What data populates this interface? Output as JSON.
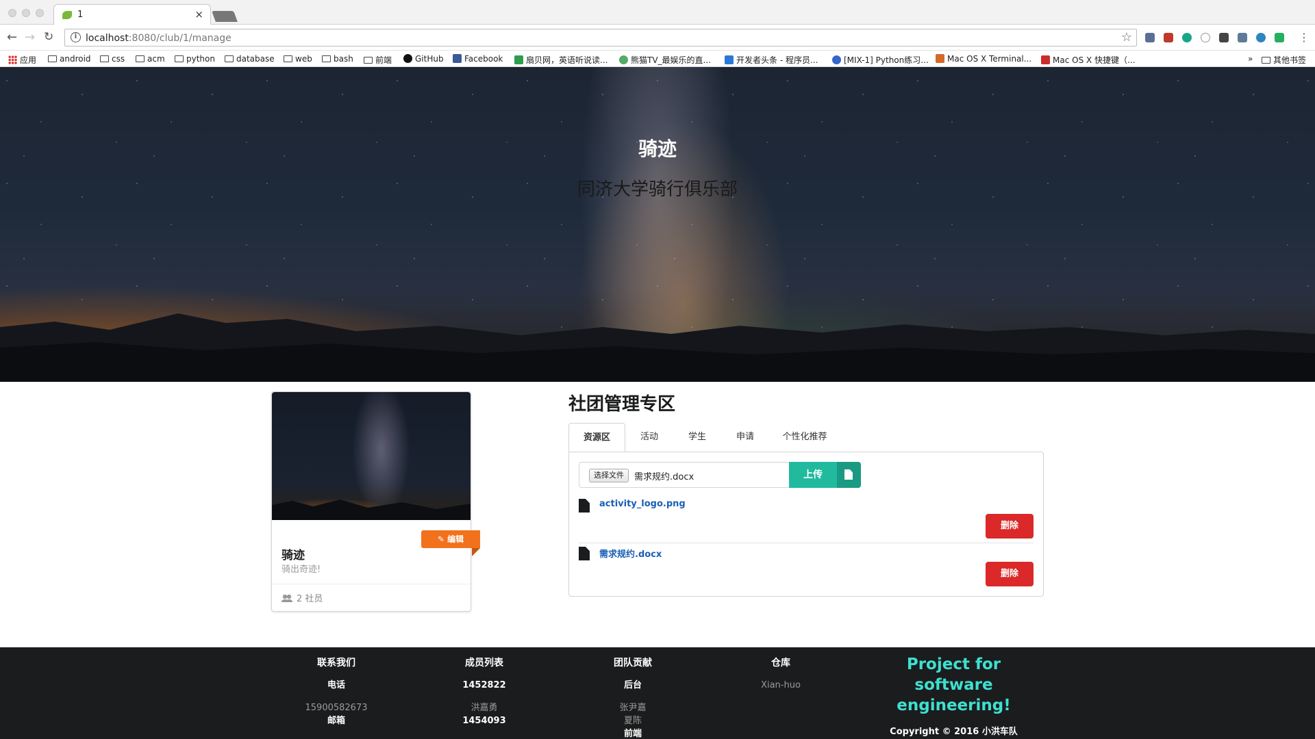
{
  "browser": {
    "tab_title": "1",
    "tab_close": "×",
    "url_host": "localhost",
    "url_path": ":8080/club/1/manage",
    "bookmarks": [
      {
        "label": "应用",
        "kind": "apps"
      },
      {
        "label": "android",
        "kind": "folder"
      },
      {
        "label": "css",
        "kind": "folder"
      },
      {
        "label": "acm",
        "kind": "folder"
      },
      {
        "label": "python",
        "kind": "folder"
      },
      {
        "label": "database",
        "kind": "folder"
      },
      {
        "label": "web",
        "kind": "folder"
      },
      {
        "label": "bash",
        "kind": "folder"
      },
      {
        "label": "前端",
        "kind": "folder"
      },
      {
        "label": "GitHub",
        "kind": "site",
        "color": "#111111"
      },
      {
        "label": "Facebook",
        "kind": "site",
        "color": "#3b5998"
      },
      {
        "label": "扇贝网，英语听说读...",
        "kind": "site",
        "color": "#2e9d4c"
      },
      {
        "label": "熊猫TV_最娱乐的直...",
        "kind": "site",
        "color": "#55aa66"
      },
      {
        "label": "开发者头条 - 程序员...",
        "kind": "site",
        "color": "#2a7ad5"
      },
      {
        "label": "[MIX-1] Python练习...",
        "kind": "site",
        "color": "#3366cc"
      },
      {
        "label": "Mac OS X Terminal...",
        "kind": "site",
        "color": "#d46a2a"
      },
      {
        "label": "Mac OS X 快捷键（...",
        "kind": "site",
        "color": "#cc2b2b"
      }
    ],
    "bookmarks_overflow": "»",
    "other_bookmarks": "其他书签"
  },
  "hero": {
    "title": "骑迹",
    "subtitle": "同济大学骑行俱乐部"
  },
  "club_card": {
    "edit_label": "编辑",
    "name": "骑迹",
    "description": "骑出奇迹!",
    "members": "2 社员"
  },
  "management": {
    "title": "社团管理专区",
    "tabs": [
      "资源区",
      "活动",
      "学生",
      "申请",
      "个性化推荐"
    ],
    "active_tab": "资源区",
    "upload": {
      "choose_file_label": "选择文件",
      "selected_file": "需求规约.docx",
      "upload_label": "上传"
    },
    "files": [
      {
        "name": "activity_logo.png",
        "delete_label": "删除"
      },
      {
        "name": "需求规约.docx",
        "delete_label": "删除"
      }
    ]
  },
  "footer": {
    "contact": {
      "heading": "联系我们",
      "phone_label": "电话",
      "phone": "15900582673",
      "email_label": "邮箱"
    },
    "members": {
      "heading": "成员列表",
      "id1": "1452822",
      "name1": "洪嘉勇",
      "id2": "1454093"
    },
    "team": {
      "heading": "团队贡献",
      "role1": "后台",
      "person1": "张尹嘉",
      "person2": "夏陈",
      "role2": "前端"
    },
    "repo": {
      "heading": "仓库",
      "name": "Xian-huo"
    },
    "brand": {
      "line1": "Project for software",
      "line2": "engineering!",
      "copyright": "Copyright © 2016 小洪车队"
    }
  }
}
